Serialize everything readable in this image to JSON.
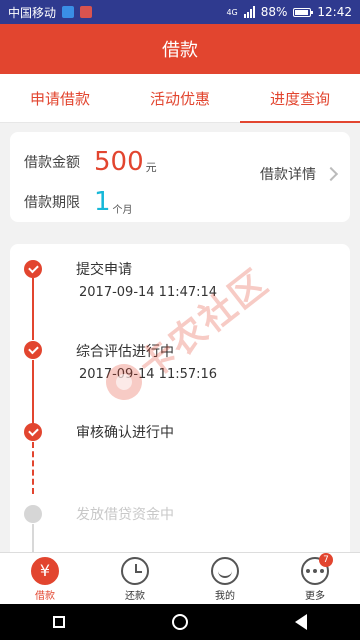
{
  "status_bar": {
    "carrier": "中国移动",
    "network": "4G",
    "battery": "88%",
    "time": "12:42",
    "left_icon_colors": [
      "#3a8ee6",
      "#d9534f"
    ]
  },
  "header": {
    "title": "借款"
  },
  "tabs": [
    {
      "label": "申请借款",
      "active": false
    },
    {
      "label": "活动优惠",
      "active": false
    },
    {
      "label": "进度查询",
      "active": true
    }
  ],
  "summary": {
    "amount_label": "借款金额",
    "amount_value": "500",
    "amount_unit": "元",
    "term_label": "借款期限",
    "term_value": "1",
    "term_unit": "个月",
    "detail_link": "借款详情"
  },
  "timeline": [
    {
      "title": "提交申请",
      "time": "2017-09-14 11:47:14",
      "state": "done"
    },
    {
      "title": "综合评估进行中",
      "time": "2017-09-14 11:57:16",
      "state": "done"
    },
    {
      "title": "审核确认进行中",
      "time": "",
      "state": "done"
    },
    {
      "title": "发放借贷资金中",
      "time": "",
      "state": "pending"
    }
  ],
  "watermark": {
    "text": "卡农社区"
  },
  "bottom_nav": [
    {
      "label": "借款",
      "icon": "yen-icon",
      "active": true
    },
    {
      "label": "还款",
      "icon": "clock-icon",
      "active": false
    },
    {
      "label": "我的",
      "icon": "profile-icon",
      "active": false
    },
    {
      "label": "更多",
      "icon": "more-icon",
      "active": false,
      "badge": "7"
    }
  ],
  "colors": {
    "accent": "#e2452f",
    "term_blue": "#16b8d8",
    "status_bar": "#2f3a8f"
  }
}
